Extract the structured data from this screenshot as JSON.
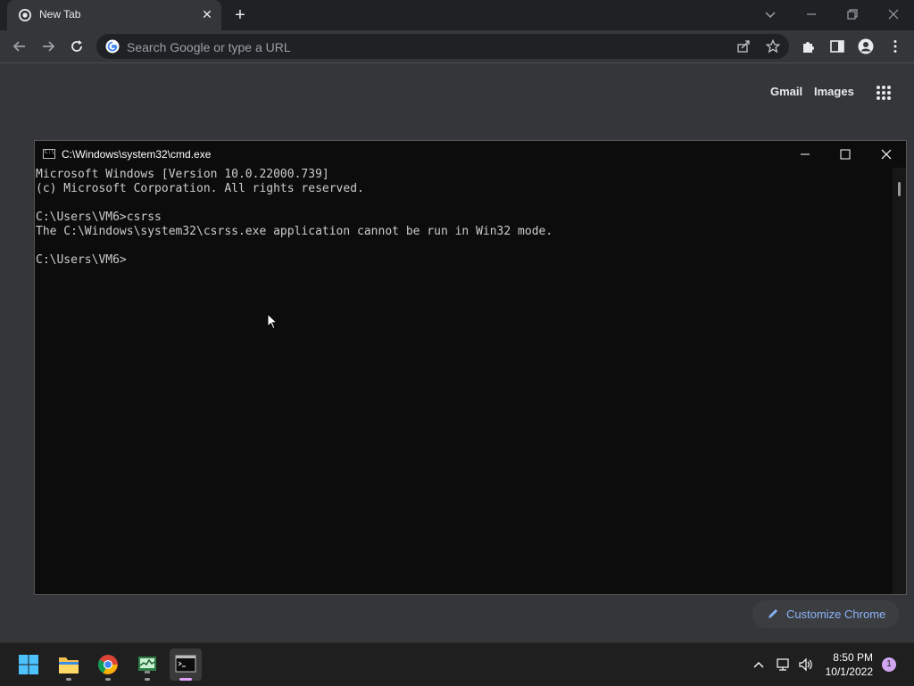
{
  "browser": {
    "tab": {
      "title": "New Tab"
    },
    "omnibox": {
      "placeholder": "Search Google or type a URL"
    },
    "ntp": {
      "gmail_label": "Gmail",
      "images_label": "Images",
      "customize_label": "Customize Chrome"
    }
  },
  "cmd": {
    "title": "C:\\Windows\\system32\\cmd.exe",
    "icon_text": "C:\\",
    "lines": [
      "Microsoft Windows [Version 10.0.22000.739]",
      "(c) Microsoft Corporation. All rights reserved.",
      "",
      "C:\\Users\\VM6>csrss",
      "The C:\\Windows\\system32\\csrss.exe application cannot be run in Win32 mode.",
      "",
      "C:\\Users\\VM6>"
    ]
  },
  "taskbar": {
    "time": "8:50 PM",
    "date": "10/1/2022",
    "notification_count": "1",
    "apps": [
      "start-icon",
      "file-explorer-icon",
      "chrome-icon",
      "task-manager-icon",
      "terminal-icon"
    ]
  },
  "colors": {
    "chrome_bg": "#35363a",
    "tabstrip_bg": "#202124",
    "cmd_bg": "#0c0c0c",
    "cmd_text": "#cccccc",
    "link_blue": "#8ab4f8",
    "taskbar_bg": "#1f1f1f"
  }
}
